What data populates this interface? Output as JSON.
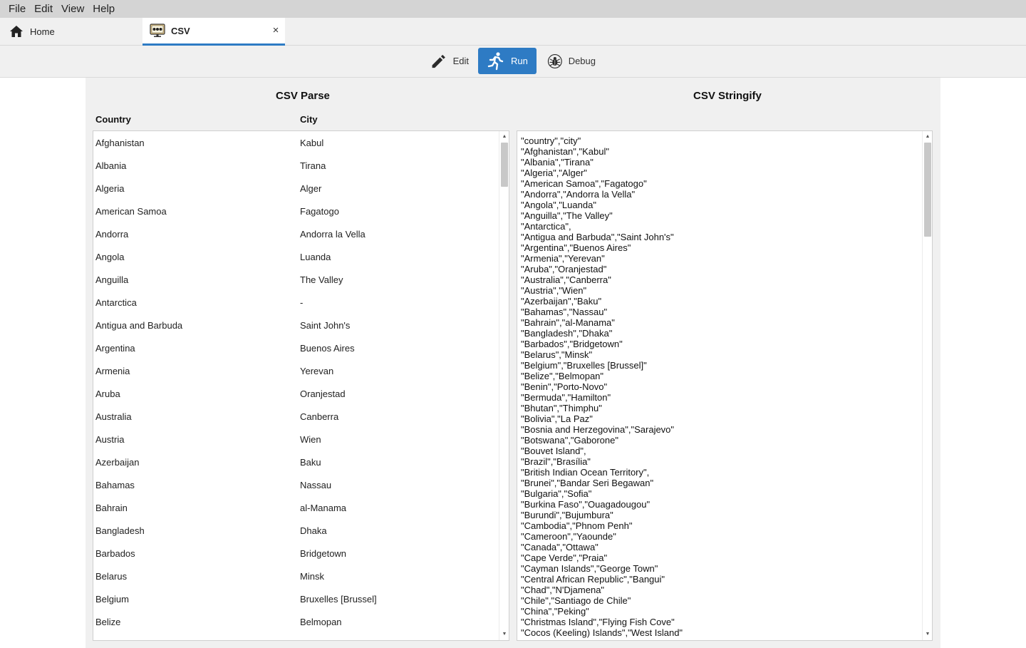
{
  "menu": [
    "File",
    "Edit",
    "View",
    "Help"
  ],
  "tabs": {
    "home": {
      "label": "Home",
      "icon": "home-icon"
    },
    "csv": {
      "label": "CSV",
      "icon": "csv-app-icon",
      "close": "×"
    }
  },
  "toolbar": {
    "edit_label": "Edit",
    "run_label": "Run",
    "debug_label": "Debug"
  },
  "colors": {
    "accent": "#2e7bc4",
    "menubar": "#d4d4d4",
    "panel": "#f0f0f0"
  },
  "parse": {
    "title": "CSV Parse",
    "columns": [
      "Country",
      "City"
    ],
    "rows": [
      [
        "Afghanistan",
        "Kabul"
      ],
      [
        "Albania",
        "Tirana"
      ],
      [
        "Algeria",
        "Alger"
      ],
      [
        "American Samoa",
        "Fagatogo"
      ],
      [
        "Andorra",
        "Andorra la Vella"
      ],
      [
        "Angola",
        "Luanda"
      ],
      [
        "Anguilla",
        "The Valley"
      ],
      [
        "Antarctica",
        "-"
      ],
      [
        "Antigua and Barbuda",
        "Saint John's"
      ],
      [
        "Argentina",
        "Buenos Aires"
      ],
      [
        "Armenia",
        "Yerevan"
      ],
      [
        "Aruba",
        "Oranjestad"
      ],
      [
        "Australia",
        "Canberra"
      ],
      [
        "Austria",
        "Wien"
      ],
      [
        "Azerbaijan",
        "Baku"
      ],
      [
        "Bahamas",
        "Nassau"
      ],
      [
        "Bahrain",
        "al-Manama"
      ],
      [
        "Bangladesh",
        "Dhaka"
      ],
      [
        "Barbados",
        "Bridgetown"
      ],
      [
        "Belarus",
        "Minsk"
      ],
      [
        "Belgium",
        "Bruxelles [Brussel]"
      ],
      [
        "Belize",
        "Belmopan"
      ]
    ]
  },
  "stringify": {
    "title": "CSV Stringify",
    "lines": [
      "\"country\",\"city\"",
      "\"Afghanistan\",\"Kabul\"",
      "\"Albania\",\"Tirana\"",
      "\"Algeria\",\"Alger\"",
      "\"American Samoa\",\"Fagatogo\"",
      "\"Andorra\",\"Andorra la Vella\"",
      "\"Angola\",\"Luanda\"",
      "\"Anguilla\",\"The Valley\"",
      "\"Antarctica\",",
      "\"Antigua and Barbuda\",\"Saint John's\"",
      "\"Argentina\",\"Buenos Aires\"",
      "\"Armenia\",\"Yerevan\"",
      "\"Aruba\",\"Oranjestad\"",
      "\"Australia\",\"Canberra\"",
      "\"Austria\",\"Wien\"",
      "\"Azerbaijan\",\"Baku\"",
      "\"Bahamas\",\"Nassau\"",
      "\"Bahrain\",\"al-Manama\"",
      "\"Bangladesh\",\"Dhaka\"",
      "\"Barbados\",\"Bridgetown\"",
      "\"Belarus\",\"Minsk\"",
      "\"Belgium\",\"Bruxelles [Brussel]\"",
      "\"Belize\",\"Belmopan\"",
      "\"Benin\",\"Porto-Novo\"",
      "\"Bermuda\",\"Hamilton\"",
      "\"Bhutan\",\"Thimphu\"",
      "\"Bolivia\",\"La Paz\"",
      "\"Bosnia and Herzegovina\",\"Sarajevo\"",
      "\"Botswana\",\"Gaborone\"",
      "\"Bouvet Island\",",
      "\"Brazil\",\"Brasília\"",
      "\"British Indian Ocean Territory\",",
      "\"Brunei\",\"Bandar Seri Begawan\"",
      "\"Bulgaria\",\"Sofia\"",
      "\"Burkina Faso\",\"Ouagadougou\"",
      "\"Burundi\",\"Bujumbura\"",
      "\"Cambodia\",\"Phnom Penh\"",
      "\"Cameroon\",\"Yaounde\"",
      "\"Canada\",\"Ottawa\"",
      "\"Cape Verde\",\"Praia\"",
      "\"Cayman Islands\",\"George Town\"",
      "\"Central African Republic\",\"Bangui\"",
      "\"Chad\",\"N'Djamena\"",
      "\"Chile\",\"Santiago de Chile\"",
      "\"China\",\"Peking\"",
      "\"Christmas Island\",\"Flying Fish Cove\"",
      "\"Cocos (Keeling) Islands\",\"West Island\""
    ]
  }
}
